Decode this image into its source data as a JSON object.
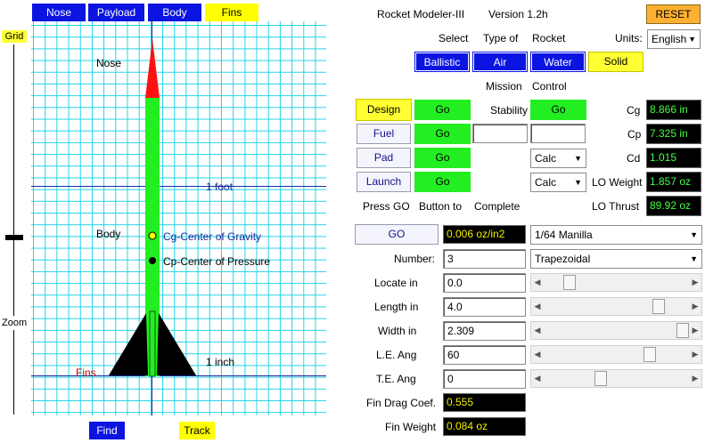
{
  "tabs": [
    {
      "label": "Nose",
      "style": "blue"
    },
    {
      "label": "Payload",
      "style": "blue"
    },
    {
      "label": "Body",
      "style": "blue"
    },
    {
      "label": "Fins",
      "style": "yellow"
    }
  ],
  "left": {
    "grid_button": "Grid",
    "zoom_label": "Zoom",
    "zoom_level": 0.5
  },
  "canvas": {
    "nose_label": "Nose",
    "body_label": "Body",
    "fins_label": "Fins",
    "one_foot": "1 foot",
    "one_inch": "1 inch",
    "cg_label": "Cg-Center of Gravity",
    "cp_label": "Cp-Center of Pressure"
  },
  "bottom": {
    "find": "Find",
    "track": "Track"
  },
  "header": {
    "app_name": "Rocket  Modeler-III",
    "version": "Version  1.2h",
    "reset": "RESET"
  },
  "type_select": {
    "word1": "Select",
    "word2": "Type of",
    "word3": "Rocket",
    "units_label": "Units:",
    "units_value": "English",
    "options": [
      "Ballistic",
      "Air",
      "Water",
      "Solid"
    ]
  },
  "mission": {
    "word1": "Mission",
    "word2": "Control",
    "design": "Design",
    "fuel": "Fuel",
    "pad": "Pad",
    "launch": "Launch",
    "go": "Go",
    "stability": "Stability",
    "stability_value": "Go",
    "calc": "Calc",
    "press_go": "Press GO",
    "button_to": "Button to",
    "complete": "Complete"
  },
  "readouts": {
    "cg_label": "Cg",
    "cg_value": "8.866 in",
    "cp_label": "Cp",
    "cp_value": "7.325 in",
    "cd_label": "Cd",
    "cd_value": "1.015",
    "lo_weight_label": "LO Weight",
    "lo_weight_value": "1.857 oz",
    "lo_thrust_label": "LO Thrust",
    "lo_thrust_value": "89.92 oz"
  },
  "fins": {
    "go": "GO",
    "density": "0.006 oz/in2",
    "material": "1/64 Manilla",
    "shape": "Trapezoidal",
    "number_label": "Number:",
    "number_value": "3",
    "locate_label": "Locate in",
    "locate_value": "0.0",
    "length_label": "Length in",
    "length_value": "4.0",
    "width_label": "Width in",
    "width_value": "2.309",
    "le_label": "L.E. Ang",
    "le_value": "60",
    "te_label": "T.E. Ang",
    "te_value": "0",
    "drag_label": "Fin Drag Coef.",
    "drag_value": "0.555",
    "weight_label": "Fin Weight",
    "weight_value": "0.084 oz",
    "slider_levels": {
      "locate": 0.15,
      "length": 0.82,
      "width": 1.0,
      "le_angle": 0.75,
      "te_angle": 0.38
    }
  }
}
